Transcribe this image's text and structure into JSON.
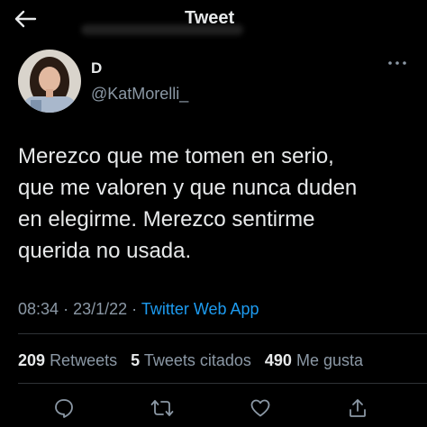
{
  "header": {
    "title": "Tweet",
    "back_icon": "arrow-left-icon"
  },
  "author": {
    "display_name": "D",
    "handle": "@KatMorelli_"
  },
  "tweet": {
    "lines": [
      "Merezco que me tomen en serio,",
      "que me valoren y que nunca duden",
      "en elegirme. Merezco sentirme",
      "querida no usada."
    ],
    "time": "08:34",
    "separator": "·",
    "date": "23/1/22",
    "source": "Twitter Web App"
  },
  "stats": {
    "retweets_count": "209",
    "retweets_label": "Retweets",
    "quotes_count": "5",
    "quotes_label": "Tweets citados",
    "likes_count": "490",
    "likes_label": "Me gusta"
  },
  "actions": [
    "reply-icon",
    "retweet-icon",
    "like-icon",
    "share-icon"
  ],
  "colors": {
    "background": "#000000",
    "text": "#e7e9ea",
    "secondary": "#8b98a5",
    "link": "#1d9bf0",
    "divider": "#2f3336"
  }
}
